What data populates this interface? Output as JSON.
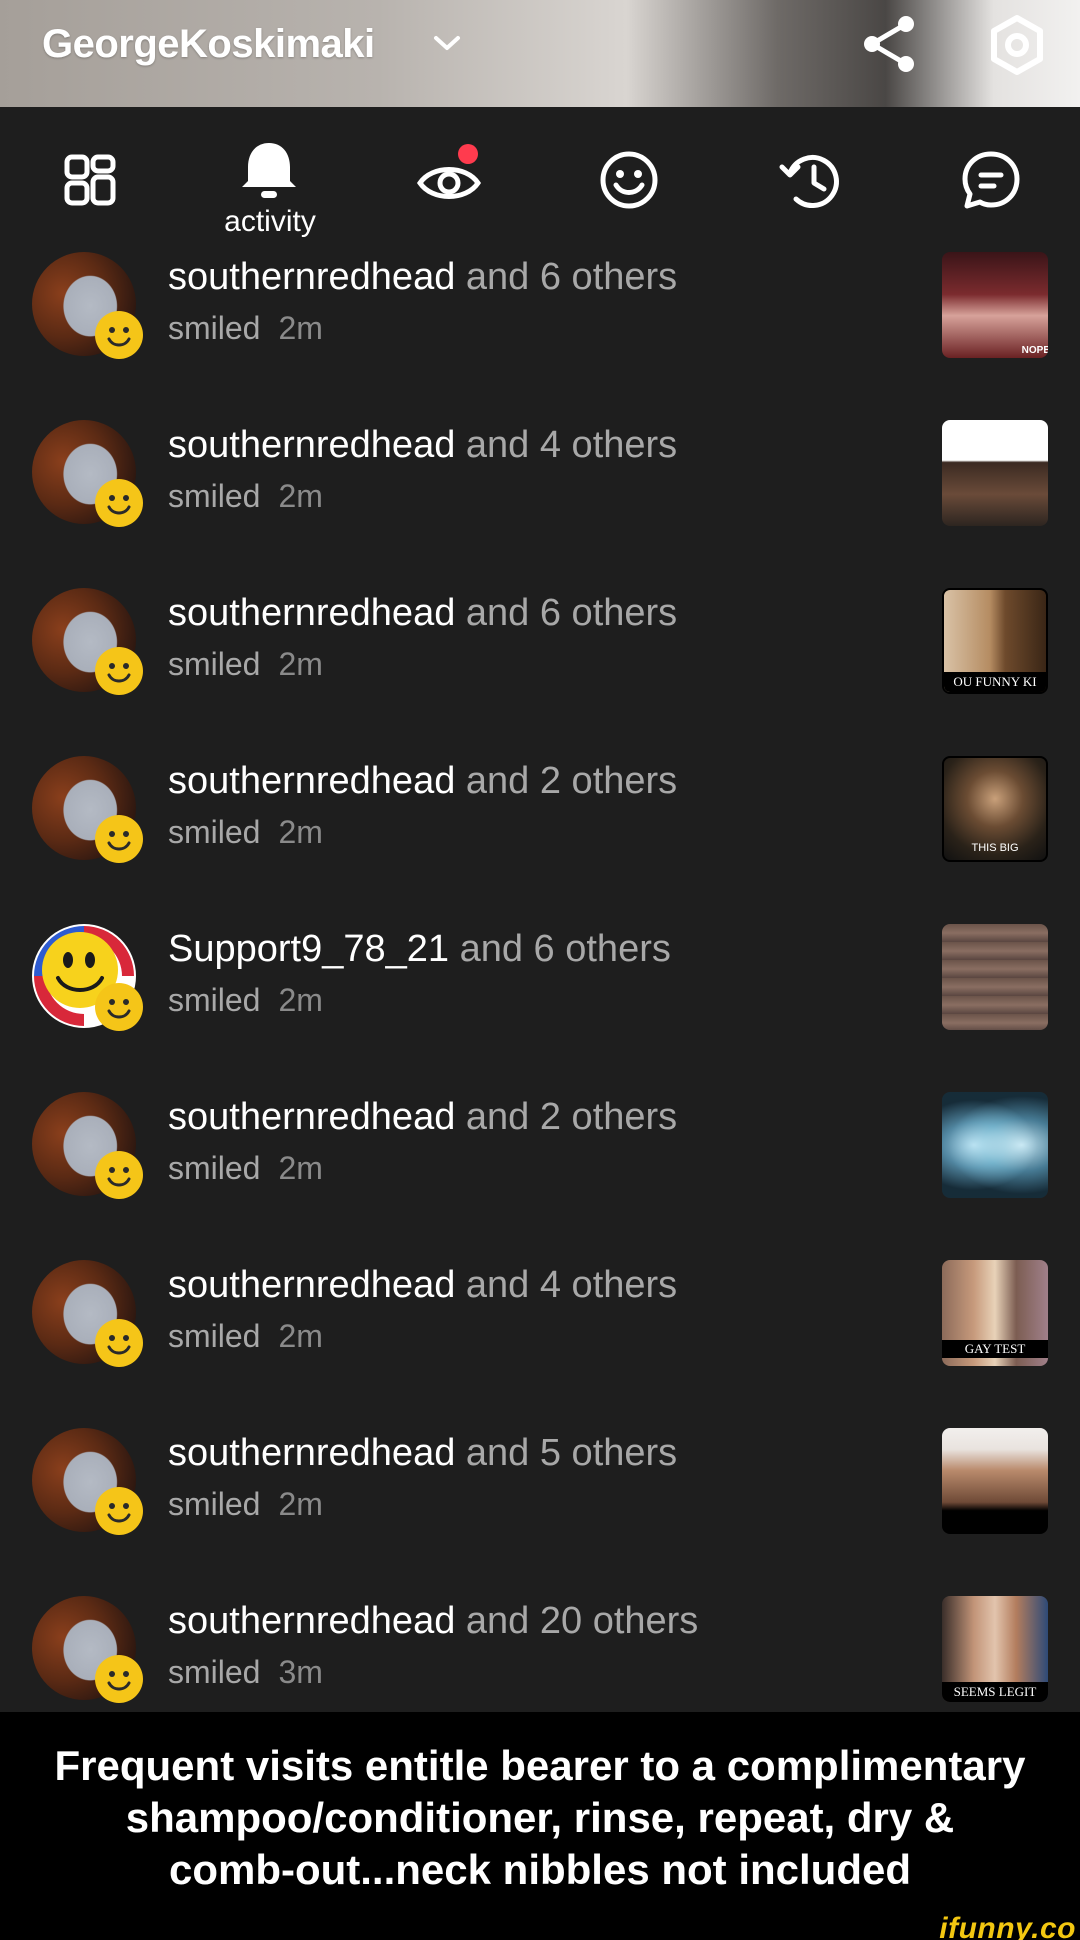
{
  "header": {
    "username": "GeorgeKoskimaki",
    "share_icon": "share-icon",
    "settings_icon": "settings-icon"
  },
  "tabs": [
    {
      "icon": "grid-icon",
      "label": ""
    },
    {
      "icon": "bell-icon",
      "label": "activity",
      "active": true
    },
    {
      "icon": "eye-icon",
      "label": "",
      "has_notification": true
    },
    {
      "icon": "smiley-icon",
      "label": ""
    },
    {
      "icon": "history-icon",
      "label": ""
    },
    {
      "icon": "chat-icon",
      "label": ""
    }
  ],
  "feed": [
    {
      "user": "southernredhead",
      "others": "and 6 others",
      "action": "smiled",
      "time": "2m",
      "avatar": "hair",
      "thumb_caption": "NOPE"
    },
    {
      "user": "southernredhead",
      "others": "and 4 others",
      "action": "smiled",
      "time": "2m",
      "avatar": "hair",
      "thumb_caption": ""
    },
    {
      "user": "southernredhead",
      "others": "and 6 others",
      "action": "smiled",
      "time": "2m",
      "avatar": "hair",
      "thumb_caption": "OU FUNNY KI"
    },
    {
      "user": "southernredhead",
      "others": "and 2 others",
      "action": "smiled",
      "time": "2m",
      "avatar": "hair",
      "thumb_caption": "THIS BIG"
    },
    {
      "user": "Support9_78_21",
      "others": "and 6 others",
      "action": "smiled",
      "time": "2m",
      "avatar": "smiley",
      "thumb_caption": ""
    },
    {
      "user": "southernredhead",
      "others": "and 2 others",
      "action": "smiled",
      "time": "2m",
      "avatar": "hair",
      "thumb_caption": ""
    },
    {
      "user": "southernredhead",
      "others": "and 4 others",
      "action": "smiled",
      "time": "2m",
      "avatar": "hair",
      "thumb_caption": "GAY TEST"
    },
    {
      "user": "southernredhead",
      "others": "and 5 others",
      "action": "smiled",
      "time": "2m",
      "avatar": "hair",
      "thumb_caption": ""
    },
    {
      "user": "southernredhead",
      "others": "and 20 others",
      "action": "smiled",
      "time": "3m",
      "avatar": "hair",
      "thumb_caption": "SEEMS LEGIT"
    }
  ],
  "caption": {
    "lines": [
      "Frequent visits entitle bearer to a complimentary",
      "shampoo/conditioner, rinse, repeat, dry &",
      "comb-out...neck nibbles not included"
    ]
  },
  "watermark": "ifunny.co",
  "colors": {
    "background": "#1e1e1e",
    "badge": "#f5c518",
    "notification": "#ff3b4e",
    "secondary_text": "#a8a8a8"
  }
}
